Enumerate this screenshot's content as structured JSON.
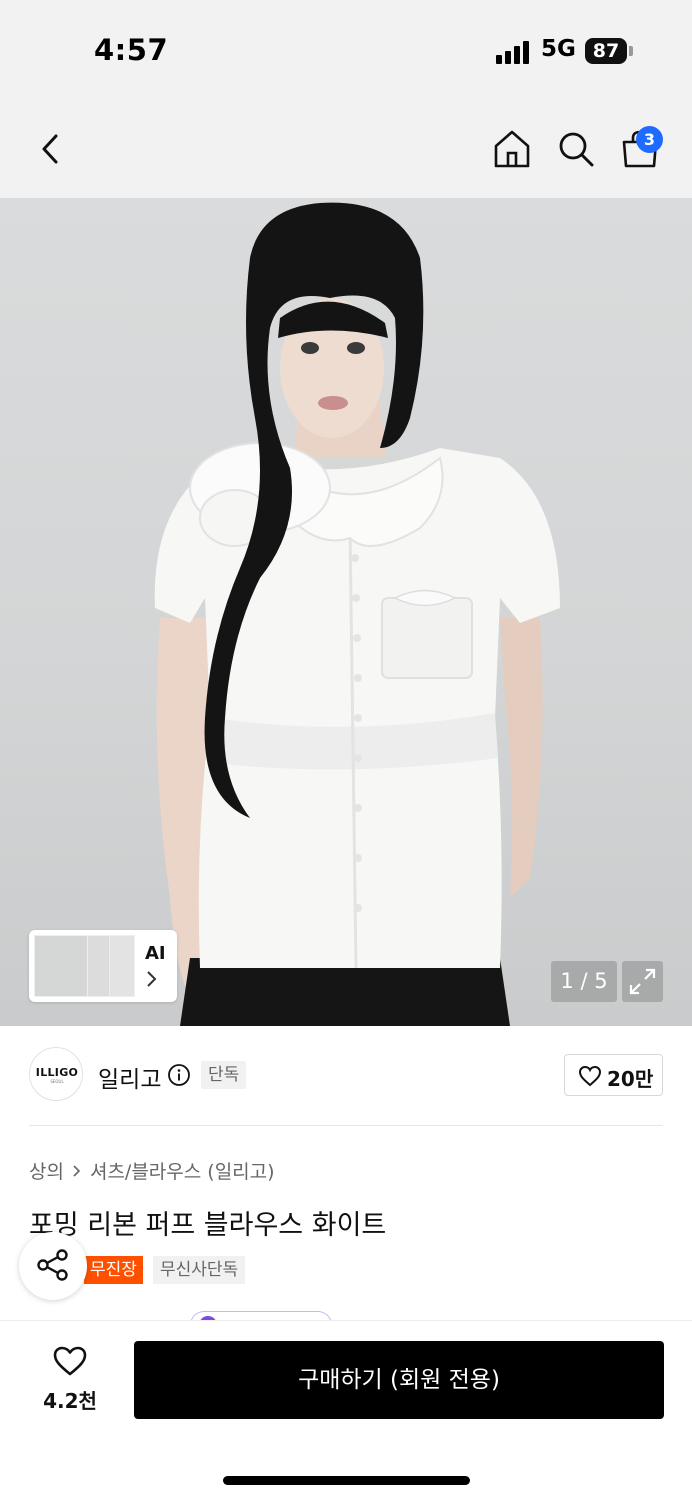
{
  "status_bar": {
    "time": "4:57",
    "network": "5G",
    "battery": "87"
  },
  "nav": {
    "back_icon": "chevron-left-icon",
    "home_icon": "home-icon",
    "search_icon": "search-icon",
    "cart_icon": "shopping-bag-icon",
    "cart_count": "3",
    "badge_color": "#1f6bff"
  },
  "gallery": {
    "ai_label": "AI",
    "counter": "1 / 5",
    "expand_icon": "expand-icon"
  },
  "brand": {
    "logo_text": "ILLIGO",
    "logo_subtext": "SEOUL",
    "name": "일리고",
    "exclusive_tag": "단독",
    "like_count": "20만"
  },
  "product": {
    "breadcrumb": [
      "상의",
      "셔츠/블라우스 (일리고)"
    ],
    "title": "포밍 리본 퍼프 블라우스 화이트",
    "tags": {
      "free_install": "무진장",
      "musinsa_exclusive": "무신사단독"
    },
    "free_tag_color": "#ff5000"
  },
  "bottom_bar": {
    "wish_count": "4.2천",
    "buy_label": "구매하기 (회원 전용)"
  }
}
